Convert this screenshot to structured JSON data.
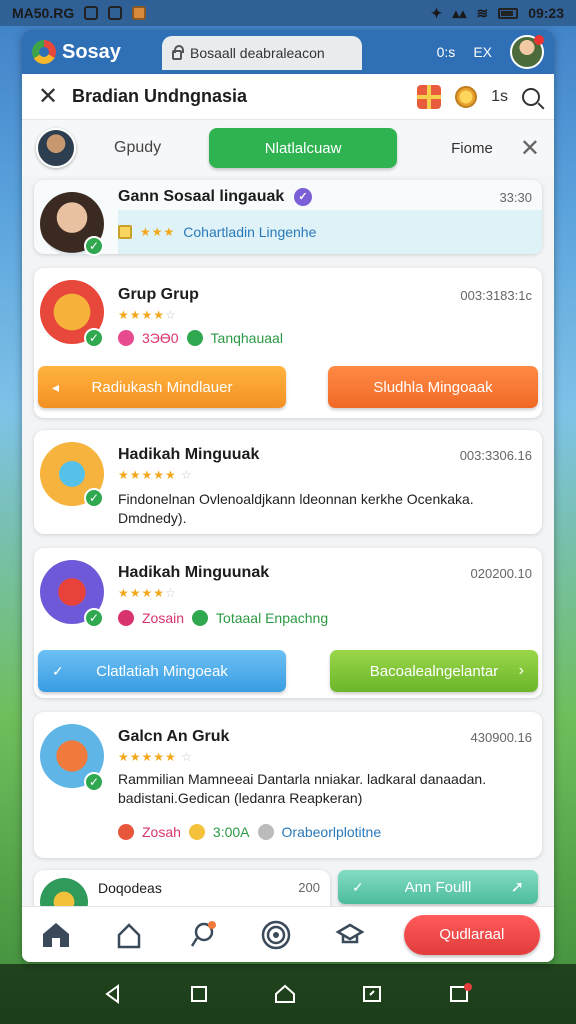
{
  "status_bar": {
    "left_text": "MA50.RG",
    "time": "09:23"
  },
  "browser": {
    "brand": "Sosay",
    "tab_title": "Bosaall deabraleacon",
    "right_label_1": "0:s",
    "right_label_2": "EX"
  },
  "titlebar": {
    "title": "Bradian Undngnasia",
    "count": "1s"
  },
  "filters": {
    "group": "Gpudy",
    "active": "Nlatlalcuaw",
    "right": "Fiome"
  },
  "cards": [
    {
      "name": "Gann Sosaal lingauak",
      "time": "33:30",
      "highlight": "Cohartladin Lingenhe"
    },
    {
      "name": "Grup Grup",
      "time": "003:3183:1c",
      "stat_1": "3ЭӨ0",
      "stat_2": "Tanqhauaal",
      "btn_left": "Radiukash Mindlauer",
      "btn_right": "Sludhla Mingoaak"
    },
    {
      "name": "Hadikah Minguuak",
      "time": "003:3306.16",
      "body": "Findonelnan Ovlenoaldjkann ldeonnan kerkhe Ocenkaka. Dmdnedy)."
    },
    {
      "name": "Hadikah Minguunak",
      "time": "020200.10",
      "stat_1": "Zosain",
      "stat_2": "Totaaal Enpachng",
      "btn_left": "Clatlatiah Mingoeak",
      "btn_right": "Bacoalealngelantar"
    },
    {
      "name": "Galcn An Gruk",
      "time": "430900.16",
      "body": "Rammilian Mamneeai Dantarla nniakar. ladkaral danaadan. badistani.Gedican (ledanra Reapkeran)",
      "stat_1": "Zosah",
      "stat_2": "3:00A",
      "stat_3": "Orabeorlplotitne"
    },
    {
      "name": "Doqodeas",
      "time": "200",
      "btn_right": "Ann Foulll"
    }
  ],
  "bottom_nav": {
    "primary": "Qudlaraal"
  },
  "colors": {
    "accent_green": "#2fb351",
    "accent_red": "#e23c3c",
    "brand_blue": "#2f6fb6"
  }
}
